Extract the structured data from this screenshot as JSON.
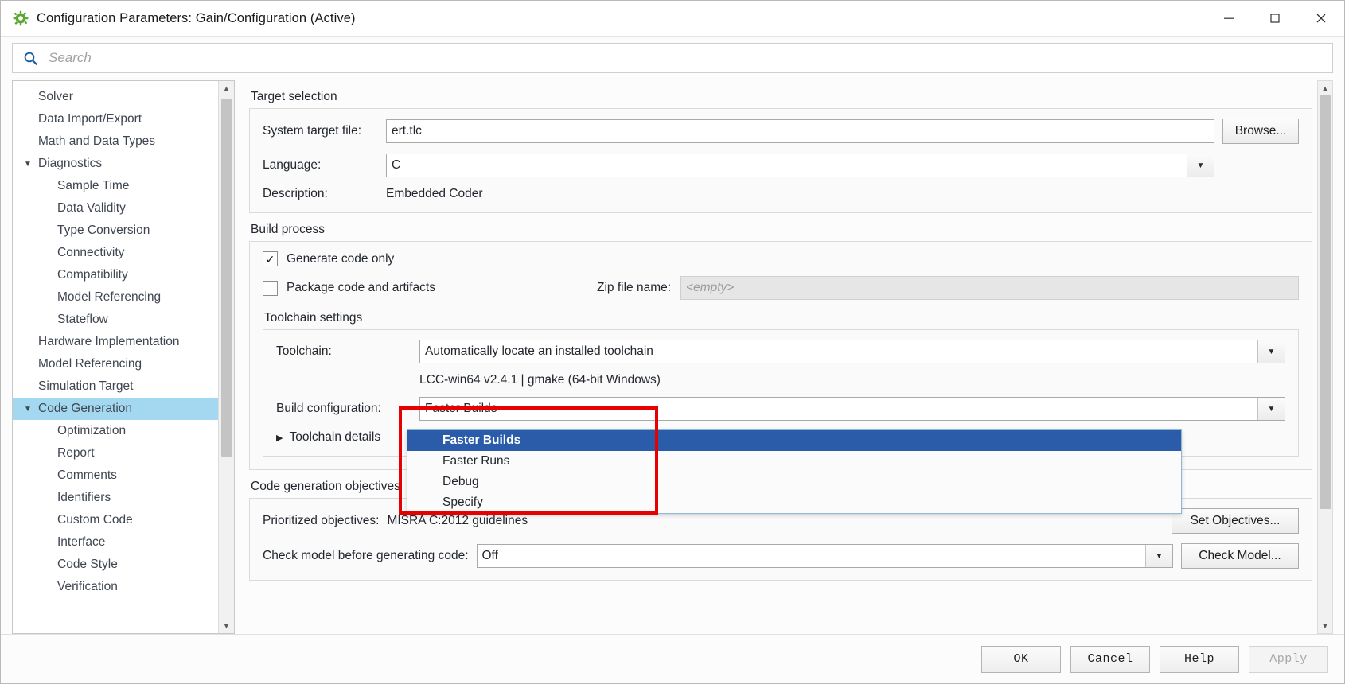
{
  "window": {
    "title": "Configuration Parameters: Gain/Configuration (Active)",
    "icon": "simulink-gear-icon",
    "minimize": "—",
    "maximize": "☐",
    "close": "✕"
  },
  "search": {
    "placeholder": "Search",
    "value": "",
    "icon": "search-icon"
  },
  "tree": {
    "items": [
      {
        "label": "Solver",
        "level": 1,
        "arrow": "",
        "selected": false
      },
      {
        "label": "Data Import/Export",
        "level": 1,
        "arrow": "",
        "selected": false
      },
      {
        "label": "Math and Data Types",
        "level": 1,
        "arrow": "",
        "selected": false
      },
      {
        "label": "Diagnostics",
        "level": 1,
        "arrow": "▼",
        "selected": false
      },
      {
        "label": "Sample Time",
        "level": 2,
        "arrow": "",
        "selected": false
      },
      {
        "label": "Data Validity",
        "level": 2,
        "arrow": "",
        "selected": false
      },
      {
        "label": "Type Conversion",
        "level": 2,
        "arrow": "",
        "selected": false
      },
      {
        "label": "Connectivity",
        "level": 2,
        "arrow": "",
        "selected": false
      },
      {
        "label": "Compatibility",
        "level": 2,
        "arrow": "",
        "selected": false
      },
      {
        "label": "Model Referencing",
        "level": 2,
        "arrow": "",
        "selected": false
      },
      {
        "label": "Stateflow",
        "level": 2,
        "arrow": "",
        "selected": false
      },
      {
        "label": "Hardware Implementation",
        "level": 1,
        "arrow": "",
        "selected": false
      },
      {
        "label": "Model Referencing",
        "level": 1,
        "arrow": "",
        "selected": false
      },
      {
        "label": "Simulation Target",
        "level": 1,
        "arrow": "",
        "selected": false
      },
      {
        "label": "Code Generation",
        "level": 1,
        "arrow": "▼",
        "selected": true
      },
      {
        "label": "Optimization",
        "level": 2,
        "arrow": "",
        "selected": false
      },
      {
        "label": "Report",
        "level": 2,
        "arrow": "",
        "selected": false
      },
      {
        "label": "Comments",
        "level": 2,
        "arrow": "",
        "selected": false
      },
      {
        "label": "Identifiers",
        "level": 2,
        "arrow": "",
        "selected": false
      },
      {
        "label": "Custom Code",
        "level": 2,
        "arrow": "",
        "selected": false
      },
      {
        "label": "Interface",
        "level": 2,
        "arrow": "",
        "selected": false
      },
      {
        "label": "Code Style",
        "level": 2,
        "arrow": "",
        "selected": false
      },
      {
        "label": "Verification",
        "level": 2,
        "arrow": "",
        "selected": false
      }
    ],
    "scroll_up": "▲",
    "scroll_down": "▼"
  },
  "target_selection": {
    "group_title": "Target selection",
    "system_target_file_label": "System target file:",
    "system_target_file_value": "ert.tlc",
    "browse_label": "Browse...",
    "language_label": "Language:",
    "language_value": "C",
    "description_label": "Description:",
    "description_value": "Embedded Coder"
  },
  "build_process": {
    "group_title": "Build process",
    "generate_code_only_label": "Generate code only",
    "generate_code_only_checked": true,
    "generate_code_only_mark": "✓",
    "package_code_label": "Package code and artifacts",
    "package_code_checked": false,
    "zip_file_name_label": "Zip file name:",
    "zip_file_name_value": "<empty>",
    "toolchain_settings_title": "Toolchain settings",
    "toolchain_label": "Toolchain:",
    "toolchain_value": "Automatically locate an installed toolchain",
    "toolchain_info": "LCC-win64 v2.4.1 | gmake (64-bit Windows)",
    "build_configuration_label": "Build configuration:",
    "build_configuration_value": "Faster Builds",
    "toolchain_details_label": "Toolchain details",
    "toolchain_details_arrow": "▶"
  },
  "build_config_dropdown": {
    "open": true,
    "highlight_color": "#e60000",
    "selected_color": "#2a5caa",
    "options": [
      {
        "label": "Faster Builds",
        "selected": true
      },
      {
        "label": "Faster Runs",
        "selected": false
      },
      {
        "label": "Debug",
        "selected": false
      },
      {
        "label": "Specify",
        "selected": false
      }
    ]
  },
  "code_generation_objectives": {
    "group_title": "Code generation objectives",
    "prioritized_objectives_label": "Prioritized objectives:",
    "prioritized_objectives_value": "MISRA C:2012 guidelines",
    "set_objectives_label": "Set Objectives...",
    "check_model_label_text": "Check model before generating code:",
    "check_model_value": "Off",
    "check_model_button": "Check Model..."
  },
  "footer": {
    "ok": "OK",
    "cancel": "Cancel",
    "help": "Help",
    "apply": "Apply",
    "apply_disabled": true
  },
  "icons": {
    "chevron_down": "▼",
    "chevron_up": "▲",
    "chevron_right": "▶"
  }
}
